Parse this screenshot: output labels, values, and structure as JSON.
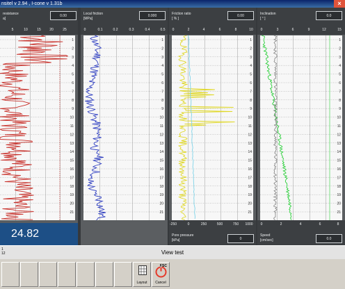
{
  "window": {
    "title": "nsitel v 2.94 , I-cone v 1.31b",
    "close_glyph": "×"
  },
  "panels": [
    {
      "id": "tip-resistance",
      "name": "resistance",
      "unit": "a]",
      "value": "0.00",
      "ticks": [
        "5",
        "10",
        "15",
        "20",
        "25"
      ],
      "color": "#c8312b"
    },
    {
      "id": "local-friction",
      "name": "Local friction",
      "unit": "[MPa]",
      "value": "0.000",
      "ticks": [
        "0",
        "0.1",
        "0.2",
        "0.3",
        "0.4",
        "0.5"
      ],
      "color": "#2d3dc0"
    },
    {
      "id": "friction-ratio",
      "name": "Friction ratio",
      "unit": "[ % ]",
      "value": "0.00",
      "ticks": [
        "0",
        "2",
        "4",
        "6",
        "8",
        "10"
      ],
      "color": "#e0d828"
    },
    {
      "id": "inclination",
      "name": "Inclination",
      "unit": "[ ° ]",
      "value": "0.0",
      "ticks": [
        "0",
        "3",
        "6",
        "9",
        "12",
        "15"
      ],
      "color": "#2ccf3b"
    }
  ],
  "pore_pressure": {
    "name": "Pore pressure",
    "unit": "[kPa]",
    "value": "0",
    "ticks": [
      "-250",
      "0",
      "250",
      "500",
      "750",
      "1000"
    ],
    "color": "#7fd3e8"
  },
  "speed": {
    "name": "Speed",
    "unit": "[cm/sec]",
    "value": "0.0",
    "ticks": [
      "0",
      "2",
      "4",
      "6",
      "8"
    ],
    "color": "#ffffff"
  },
  "depth_labels": [
    "1",
    "2",
    "3",
    "4",
    "5",
    "6",
    "7",
    "8",
    "9",
    "10",
    "11",
    "12",
    "13",
    "14",
    "15",
    "16",
    "17",
    "18",
    "19",
    "20",
    "21"
  ],
  "big_value": "24.82",
  "status": {
    "line1": "1",
    "line2": "12",
    "title": "View test"
  },
  "toolbar": {
    "layout_label": "Layout",
    "cancel_label": "Cancel",
    "esc_label": "ESC"
  }
}
